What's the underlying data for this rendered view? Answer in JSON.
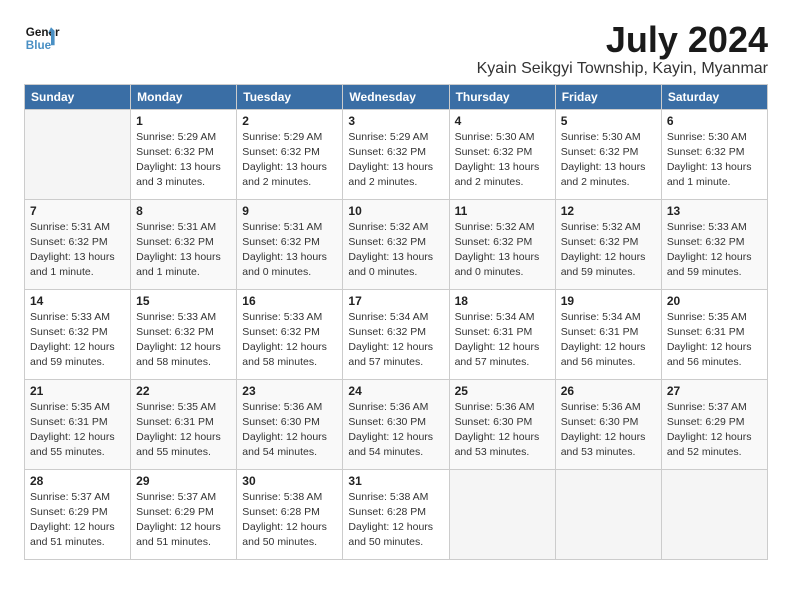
{
  "header": {
    "logo_line1": "General",
    "logo_line2": "Blue",
    "month": "July 2024",
    "location": "Kyain Seikgyi Township, Kayin, Myanmar"
  },
  "weekdays": [
    "Sunday",
    "Monday",
    "Tuesday",
    "Wednesday",
    "Thursday",
    "Friday",
    "Saturday"
  ],
  "weeks": [
    [
      {
        "day": "",
        "info": ""
      },
      {
        "day": "1",
        "info": "Sunrise: 5:29 AM\nSunset: 6:32 PM\nDaylight: 13 hours\nand 3 minutes."
      },
      {
        "day": "2",
        "info": "Sunrise: 5:29 AM\nSunset: 6:32 PM\nDaylight: 13 hours\nand 2 minutes."
      },
      {
        "day": "3",
        "info": "Sunrise: 5:29 AM\nSunset: 6:32 PM\nDaylight: 13 hours\nand 2 minutes."
      },
      {
        "day": "4",
        "info": "Sunrise: 5:30 AM\nSunset: 6:32 PM\nDaylight: 13 hours\nand 2 minutes."
      },
      {
        "day": "5",
        "info": "Sunrise: 5:30 AM\nSunset: 6:32 PM\nDaylight: 13 hours\nand 2 minutes."
      },
      {
        "day": "6",
        "info": "Sunrise: 5:30 AM\nSunset: 6:32 PM\nDaylight: 13 hours\nand 1 minute."
      }
    ],
    [
      {
        "day": "7",
        "info": "Sunrise: 5:31 AM\nSunset: 6:32 PM\nDaylight: 13 hours\nand 1 minute."
      },
      {
        "day": "8",
        "info": "Sunrise: 5:31 AM\nSunset: 6:32 PM\nDaylight: 13 hours\nand 1 minute."
      },
      {
        "day": "9",
        "info": "Sunrise: 5:31 AM\nSunset: 6:32 PM\nDaylight: 13 hours\nand 0 minutes."
      },
      {
        "day": "10",
        "info": "Sunrise: 5:32 AM\nSunset: 6:32 PM\nDaylight: 13 hours\nand 0 minutes."
      },
      {
        "day": "11",
        "info": "Sunrise: 5:32 AM\nSunset: 6:32 PM\nDaylight: 13 hours\nand 0 minutes."
      },
      {
        "day": "12",
        "info": "Sunrise: 5:32 AM\nSunset: 6:32 PM\nDaylight: 12 hours\nand 59 minutes."
      },
      {
        "day": "13",
        "info": "Sunrise: 5:33 AM\nSunset: 6:32 PM\nDaylight: 12 hours\nand 59 minutes."
      }
    ],
    [
      {
        "day": "14",
        "info": "Sunrise: 5:33 AM\nSunset: 6:32 PM\nDaylight: 12 hours\nand 59 minutes."
      },
      {
        "day": "15",
        "info": "Sunrise: 5:33 AM\nSunset: 6:32 PM\nDaylight: 12 hours\nand 58 minutes."
      },
      {
        "day": "16",
        "info": "Sunrise: 5:33 AM\nSunset: 6:32 PM\nDaylight: 12 hours\nand 58 minutes."
      },
      {
        "day": "17",
        "info": "Sunrise: 5:34 AM\nSunset: 6:32 PM\nDaylight: 12 hours\nand 57 minutes."
      },
      {
        "day": "18",
        "info": "Sunrise: 5:34 AM\nSunset: 6:31 PM\nDaylight: 12 hours\nand 57 minutes."
      },
      {
        "day": "19",
        "info": "Sunrise: 5:34 AM\nSunset: 6:31 PM\nDaylight: 12 hours\nand 56 minutes."
      },
      {
        "day": "20",
        "info": "Sunrise: 5:35 AM\nSunset: 6:31 PM\nDaylight: 12 hours\nand 56 minutes."
      }
    ],
    [
      {
        "day": "21",
        "info": "Sunrise: 5:35 AM\nSunset: 6:31 PM\nDaylight: 12 hours\nand 55 minutes."
      },
      {
        "day": "22",
        "info": "Sunrise: 5:35 AM\nSunset: 6:31 PM\nDaylight: 12 hours\nand 55 minutes."
      },
      {
        "day": "23",
        "info": "Sunrise: 5:36 AM\nSunset: 6:30 PM\nDaylight: 12 hours\nand 54 minutes."
      },
      {
        "day": "24",
        "info": "Sunrise: 5:36 AM\nSunset: 6:30 PM\nDaylight: 12 hours\nand 54 minutes."
      },
      {
        "day": "25",
        "info": "Sunrise: 5:36 AM\nSunset: 6:30 PM\nDaylight: 12 hours\nand 53 minutes."
      },
      {
        "day": "26",
        "info": "Sunrise: 5:36 AM\nSunset: 6:30 PM\nDaylight: 12 hours\nand 53 minutes."
      },
      {
        "day": "27",
        "info": "Sunrise: 5:37 AM\nSunset: 6:29 PM\nDaylight: 12 hours\nand 52 minutes."
      }
    ],
    [
      {
        "day": "28",
        "info": "Sunrise: 5:37 AM\nSunset: 6:29 PM\nDaylight: 12 hours\nand 51 minutes."
      },
      {
        "day": "29",
        "info": "Sunrise: 5:37 AM\nSunset: 6:29 PM\nDaylight: 12 hours\nand 51 minutes."
      },
      {
        "day": "30",
        "info": "Sunrise: 5:38 AM\nSunset: 6:28 PM\nDaylight: 12 hours\nand 50 minutes."
      },
      {
        "day": "31",
        "info": "Sunrise: 5:38 AM\nSunset: 6:28 PM\nDaylight: 12 hours\nand 50 minutes."
      },
      {
        "day": "",
        "info": ""
      },
      {
        "day": "",
        "info": ""
      },
      {
        "day": "",
        "info": ""
      }
    ]
  ]
}
